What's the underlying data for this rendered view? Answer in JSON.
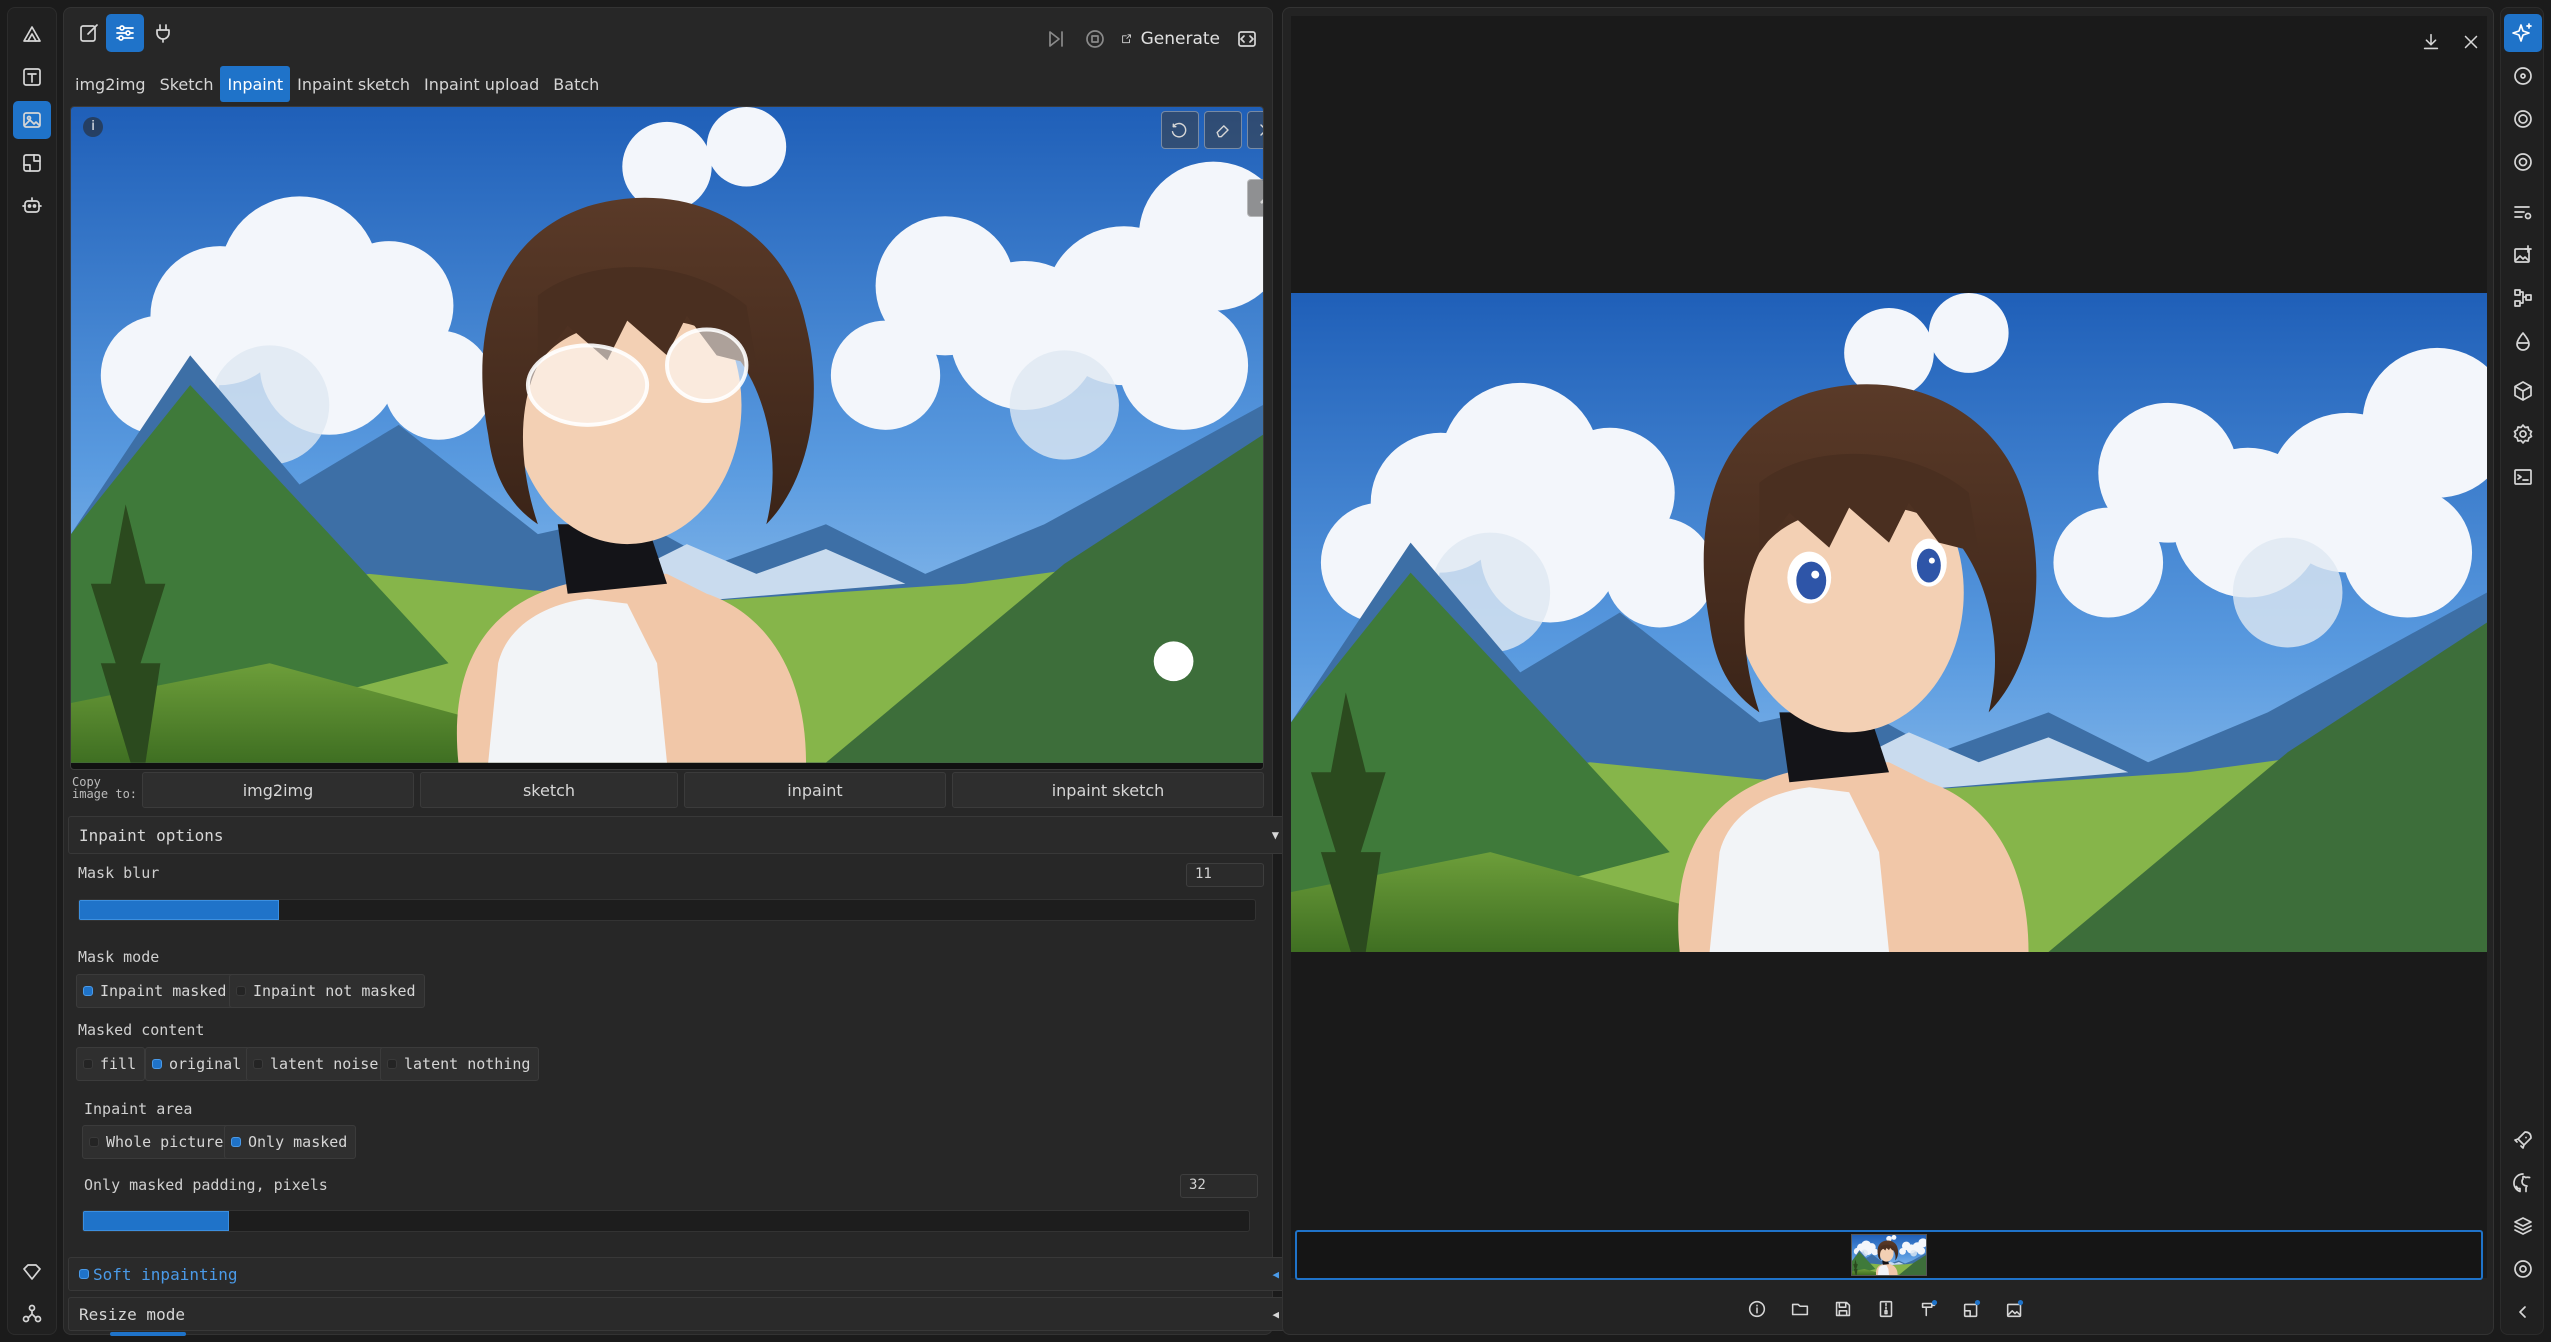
{
  "toolbar": {
    "generate_label": "Generate"
  },
  "tabs": [
    {
      "label": "img2img"
    },
    {
      "label": "Sketch"
    },
    {
      "label": "Inpaint"
    },
    {
      "label": "Inpaint sketch"
    },
    {
      "label": "Inpaint upload"
    },
    {
      "label": "Batch"
    }
  ],
  "active_tab": "Inpaint",
  "canvas": {
    "info_badge": "i"
  },
  "copy_image": {
    "label": "Copy image to:",
    "targets": [
      "img2img",
      "sketch",
      "inpaint",
      "inpaint sketch"
    ]
  },
  "inpaint_options": {
    "title": "Inpaint options",
    "mask_blur": {
      "label": "Mask blur",
      "value": "11",
      "fraction": 0.17
    },
    "mask_mode": {
      "label": "Mask mode",
      "options": [
        "Inpaint masked",
        "Inpaint not masked"
      ],
      "selected": "Inpaint masked"
    },
    "masked_content": {
      "label": "Masked content",
      "options": [
        "fill",
        "original",
        "latent noise",
        "latent nothing"
      ],
      "selected": "original"
    },
    "inpaint_area": {
      "label": "Inpaint area",
      "options": [
        "Whole picture",
        "Only masked"
      ],
      "selected": "Only masked"
    },
    "padding": {
      "label": "Only masked padding, pixels",
      "value": "32",
      "fraction": 0.125
    }
  },
  "soft_inpainting": {
    "label": "Soft inpainting",
    "checked": true
  },
  "resize_mode": {
    "label": "Resize mode"
  },
  "colors": {
    "accent": "#1f73c9",
    "background": "#1b1b1b",
    "panel": "#272727"
  },
  "icons": {
    "left_rail": [
      "logo-icon",
      "text-icon",
      "image-icon",
      "control-icon",
      "robot-icon",
      "heart-icon",
      "network-icon"
    ],
    "right_rail": [
      "sparkle-icon",
      "target-icon",
      "ring-icon",
      "disc-icon",
      "list-settings-icon",
      "image-edit-icon",
      "nodes-icon",
      "drop-icon",
      "cube-icon",
      "settings-icon",
      "terminal-icon",
      "rocket-icon",
      "github-icon",
      "layers-icon",
      "circle-icon",
      "collapse-icon"
    ],
    "gallery_footer": [
      "info-icon",
      "folder-icon",
      "save-icon",
      "zip-icon",
      "send-paint-icon",
      "send-extras-icon",
      "send-img2img-icon"
    ]
  }
}
